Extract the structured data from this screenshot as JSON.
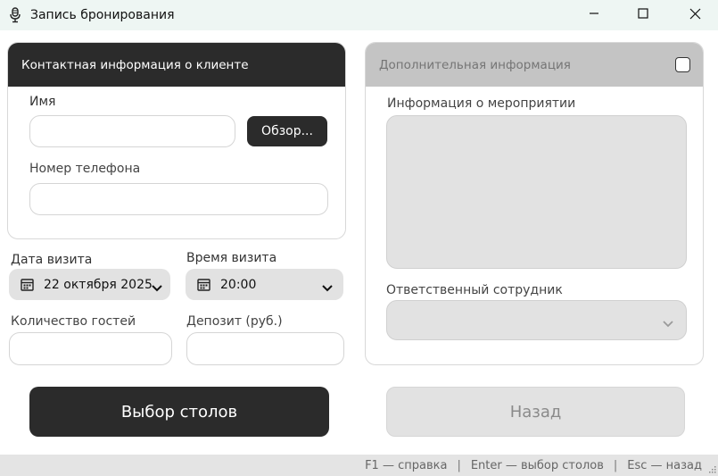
{
  "window": {
    "title": "Запись бронирования",
    "icons": {
      "app": "microphone-icon",
      "minimize": "minimize-icon",
      "maximize": "maximize-icon",
      "close": "close-icon"
    }
  },
  "contact": {
    "header": "Контактная информация о клиенте",
    "name_label": "Имя",
    "name_value": "",
    "browse_button": "Обзор...",
    "phone_label": "Номер телефона",
    "phone_value": ""
  },
  "visit": {
    "date_label": "Дата визита",
    "date_value": "22 октября 2025",
    "time_label": "Время визита",
    "time_value": "20:00",
    "guests_label": "Количество гостей",
    "guests_value": "",
    "deposit_label": "Депозит (руб.)",
    "deposit_value": ""
  },
  "extra": {
    "header": "Дополнительная информация",
    "enabled": false,
    "event_label": "Информация о мероприятии",
    "event_value": "",
    "staff_label": "Ответственный сотрудник",
    "staff_value": ""
  },
  "actions": {
    "primary": "Выбор столов",
    "back": "Назад"
  },
  "statusbar": {
    "help": "F1 — справка",
    "select": "Enter — выбор столов",
    "back": "Esc — назад"
  },
  "colors": {
    "dark": "#2b2b2b",
    "disabled_gray": "#e2e2e2",
    "header_disabled": "#c4c4c4"
  }
}
